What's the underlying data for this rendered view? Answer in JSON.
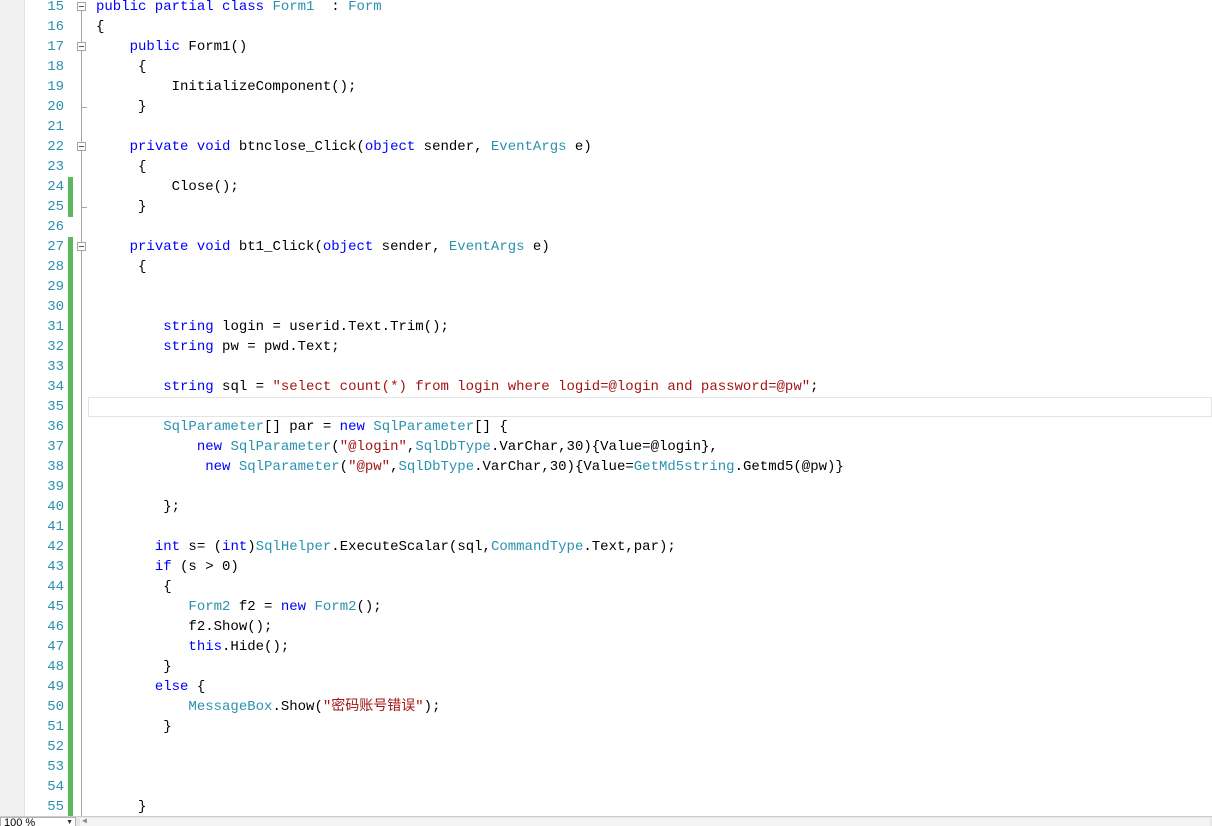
{
  "editor": {
    "lines": [
      {
        "n": "15",
        "segs": [
          [
            "kw",
            "public partial class "
          ],
          [
            "ty",
            "Form1"
          ],
          [
            "",
            "  : "
          ],
          [
            "ty",
            "Form"
          ]
        ]
      },
      {
        "n": "16",
        "segs": [
          [
            "",
            "{"
          ]
        ]
      },
      {
        "n": "17",
        "segs": [
          [
            "",
            "    "
          ],
          [
            "kw",
            "public"
          ],
          [
            "",
            " Form1()"
          ]
        ]
      },
      {
        "n": "18",
        "segs": [
          [
            "",
            "     {"
          ]
        ]
      },
      {
        "n": "19",
        "segs": [
          [
            "",
            "         InitializeComponent();"
          ]
        ]
      },
      {
        "n": "20",
        "segs": [
          [
            "",
            "     }"
          ]
        ]
      },
      {
        "n": "21",
        "segs": []
      },
      {
        "n": "22",
        "segs": [
          [
            "",
            "    "
          ],
          [
            "kw",
            "private void"
          ],
          [
            "",
            " btnclose_Click("
          ],
          [
            "kw",
            "object"
          ],
          [
            "",
            " sender, "
          ],
          [
            "ty",
            "EventArgs"
          ],
          [
            "",
            " e)"
          ]
        ]
      },
      {
        "n": "23",
        "segs": [
          [
            "",
            "     {"
          ]
        ]
      },
      {
        "n": "24",
        "segs": [
          [
            "",
            "         Close();"
          ]
        ]
      },
      {
        "n": "25",
        "segs": [
          [
            "",
            "     }"
          ]
        ]
      },
      {
        "n": "26",
        "segs": []
      },
      {
        "n": "27",
        "segs": [
          [
            "",
            "    "
          ],
          [
            "kw",
            "private void"
          ],
          [
            "",
            " bt1_Click("
          ],
          [
            "kw",
            "object"
          ],
          [
            "",
            " sender, "
          ],
          [
            "ty",
            "EventArgs"
          ],
          [
            "",
            " e)"
          ]
        ]
      },
      {
        "n": "28",
        "segs": [
          [
            "",
            "     {"
          ]
        ]
      },
      {
        "n": "29",
        "segs": []
      },
      {
        "n": "30",
        "segs": []
      },
      {
        "n": "31",
        "segs": [
          [
            "",
            "        "
          ],
          [
            "kw",
            "string"
          ],
          [
            "",
            " login = userid.Text.Trim();"
          ]
        ]
      },
      {
        "n": "32",
        "segs": [
          [
            "",
            "        "
          ],
          [
            "kw",
            "string"
          ],
          [
            "",
            " pw = pwd.Text;"
          ]
        ]
      },
      {
        "n": "33",
        "segs": []
      },
      {
        "n": "34",
        "segs": [
          [
            "",
            "        "
          ],
          [
            "kw",
            "string"
          ],
          [
            "",
            " sql = "
          ],
          [
            "st",
            "\"select count(*) from login where logid=@login and password=@pw\""
          ],
          [
            "",
            ";"
          ]
        ]
      },
      {
        "n": "35",
        "segs": []
      },
      {
        "n": "36",
        "segs": [
          [
            "",
            "        "
          ],
          [
            "ty",
            "SqlParameter"
          ],
          [
            "",
            "[] par = "
          ],
          [
            "kw",
            "new"
          ],
          [
            "",
            " "
          ],
          [
            "ty",
            "SqlParameter"
          ],
          [
            "",
            "[] {"
          ]
        ]
      },
      {
        "n": "37",
        "segs": [
          [
            "",
            "            "
          ],
          [
            "kw",
            "new"
          ],
          [
            "",
            " "
          ],
          [
            "ty",
            "SqlParameter"
          ],
          [
            "",
            "("
          ],
          [
            "st",
            "\"@login\""
          ],
          [
            "",
            ","
          ],
          [
            "ty",
            "SqlDbType"
          ],
          [
            "",
            ".VarChar,30){Value=@login},"
          ]
        ]
      },
      {
        "n": "38",
        "segs": [
          [
            "",
            "             "
          ],
          [
            "kw",
            "new"
          ],
          [
            "",
            " "
          ],
          [
            "ty",
            "SqlParameter"
          ],
          [
            "",
            "("
          ],
          [
            "st",
            "\"@pw\""
          ],
          [
            "",
            ","
          ],
          [
            "ty",
            "SqlDbType"
          ],
          [
            "",
            ".VarChar,30){Value="
          ],
          [
            "ty",
            "GetMd5string"
          ],
          [
            "",
            ".Getmd5(@pw)}"
          ]
        ]
      },
      {
        "n": "39",
        "segs": []
      },
      {
        "n": "40",
        "segs": [
          [
            "",
            "        };"
          ]
        ]
      },
      {
        "n": "41",
        "segs": []
      },
      {
        "n": "42",
        "segs": [
          [
            "",
            "       "
          ],
          [
            "kw",
            "int"
          ],
          [
            "",
            " s= ("
          ],
          [
            "kw",
            "int"
          ],
          [
            "",
            ")"
          ],
          [
            "ty",
            "SqlHelper"
          ],
          [
            "",
            ".ExecuteScalar(sql,"
          ],
          [
            "ty",
            "CommandType"
          ],
          [
            "",
            ".Text,par);"
          ]
        ]
      },
      {
        "n": "43",
        "segs": [
          [
            "",
            "       "
          ],
          [
            "kw",
            "if"
          ],
          [
            "",
            " (s > 0)"
          ]
        ]
      },
      {
        "n": "44",
        "segs": [
          [
            "",
            "        {"
          ]
        ]
      },
      {
        "n": "45",
        "segs": [
          [
            "",
            "           "
          ],
          [
            "ty",
            "Form2"
          ],
          [
            "",
            " f2 = "
          ],
          [
            "kw",
            "new"
          ],
          [
            "",
            " "
          ],
          [
            "ty",
            "Form2"
          ],
          [
            "",
            "();"
          ]
        ]
      },
      {
        "n": "46",
        "segs": [
          [
            "",
            "           f2.Show();"
          ]
        ]
      },
      {
        "n": "47",
        "segs": [
          [
            "",
            "           "
          ],
          [
            "kw",
            "this"
          ],
          [
            "",
            ".Hide();"
          ]
        ]
      },
      {
        "n": "48",
        "segs": [
          [
            "",
            "        }"
          ]
        ]
      },
      {
        "n": "49",
        "segs": [
          [
            "",
            "       "
          ],
          [
            "kw",
            "else"
          ],
          [
            "",
            " {"
          ]
        ]
      },
      {
        "n": "50",
        "segs": [
          [
            "",
            "           "
          ],
          [
            "ty",
            "MessageBox"
          ],
          [
            "",
            ".Show("
          ],
          [
            "st",
            "\"密码账号错误\""
          ],
          [
            "",
            ");"
          ]
        ]
      },
      {
        "n": "51",
        "segs": [
          [
            "",
            "        }"
          ]
        ]
      },
      {
        "n": "52",
        "segs": []
      },
      {
        "n": "53",
        "segs": []
      },
      {
        "n": "54",
        "segs": []
      },
      {
        "n": "55",
        "segs": [
          [
            "",
            "     }"
          ]
        ]
      }
    ]
  },
  "status": {
    "zoom": "100 %"
  },
  "colors": {
    "keyword": "#0000ff",
    "type": "#2b91af",
    "string": "#a31515",
    "line_number": "#2b91af",
    "change_bar": "#5cb85c"
  }
}
